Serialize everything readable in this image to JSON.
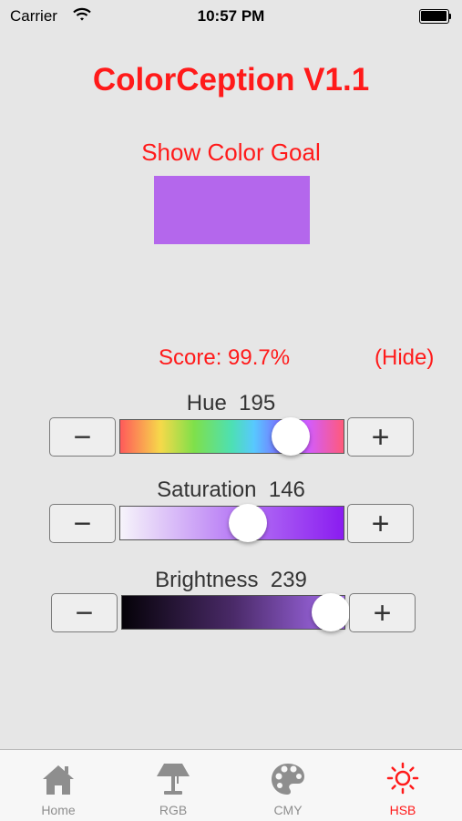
{
  "status_bar": {
    "carrier": "Carrier",
    "time": "10:57 PM"
  },
  "app": {
    "title": "ColorCeption V1.1"
  },
  "goal": {
    "button_label": "Show Color Goal",
    "swatch_color": "#b467ec"
  },
  "score": {
    "text": "Score: 99.7%",
    "hide_label": "(Hide)"
  },
  "sliders": {
    "hue": {
      "label": "Hue",
      "value": "195",
      "fraction": 0.765
    },
    "saturation": {
      "label": "Saturation",
      "value": "146",
      "fraction": 0.573
    },
    "brightness": {
      "label": "Brightness",
      "value": "239",
      "fraction": 0.937
    },
    "minus_label": "−",
    "plus_label": "+"
  },
  "tabs": [
    {
      "label": "Home",
      "icon": "home-icon",
      "active": false
    },
    {
      "label": "RGB",
      "icon": "lamp-icon",
      "active": false
    },
    {
      "label": "CMY",
      "icon": "palette-icon",
      "active": false
    },
    {
      "label": "HSB",
      "icon": "sun-icon",
      "active": true
    }
  ],
  "colors": {
    "accent": "#ff1a1a",
    "background": "#e6e6e6"
  }
}
